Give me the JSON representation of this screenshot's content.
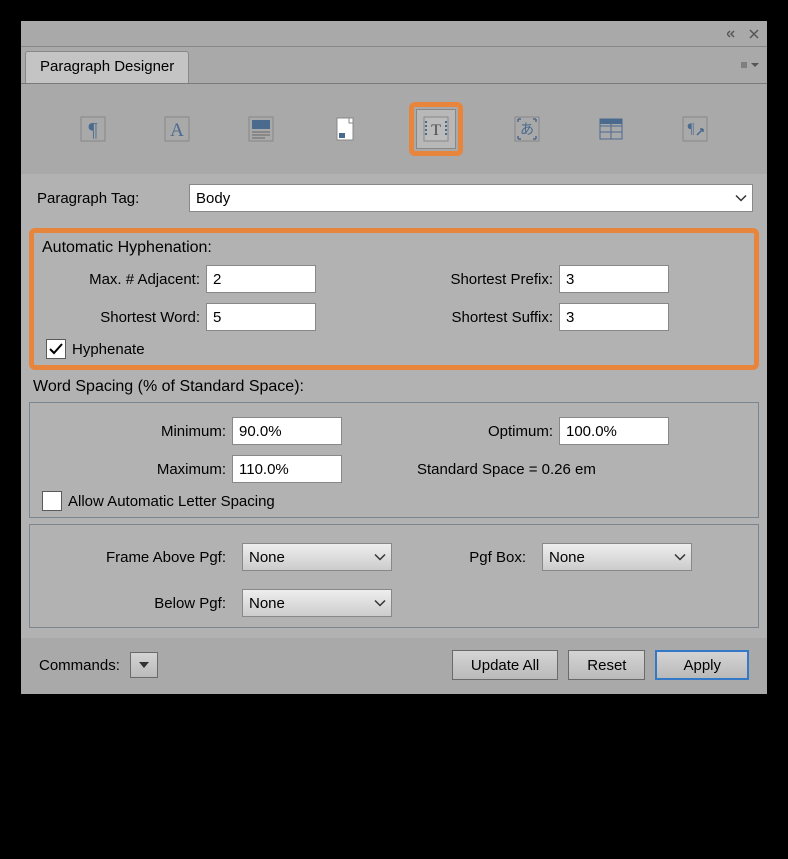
{
  "window": {
    "title": "Paragraph Designer"
  },
  "paragraphTag": {
    "label": "Paragraph Tag:",
    "value": "Body"
  },
  "hyphenation": {
    "title": "Automatic Hyphenation:",
    "maxAdjacent": {
      "label": "Max. # Adjacent:",
      "value": "2"
    },
    "shortestWord": {
      "label": "Shortest Word:",
      "value": "5"
    },
    "shortestPrefix": {
      "label": "Shortest Prefix:",
      "value": "3"
    },
    "shortestSuffix": {
      "label": "Shortest Suffix:",
      "value": "3"
    },
    "hyphenate": {
      "label": "Hyphenate",
      "checked": true
    }
  },
  "wordSpacing": {
    "title": "Word Spacing (% of Standard Space):",
    "minimum": {
      "label": "Minimum:",
      "value": "90.0%"
    },
    "maximum": {
      "label": "Maximum:",
      "value": "110.0%"
    },
    "optimum": {
      "label": "Optimum:",
      "value": "100.0%"
    },
    "standardSpace": "Standard Space = 0.26 em",
    "allowLetterSpacing": {
      "label": "Allow Automatic Letter Spacing",
      "checked": false
    }
  },
  "frames": {
    "frameAbove": {
      "label": "Frame Above Pgf:",
      "value": "None"
    },
    "belowPgf": {
      "label": "Below Pgf:",
      "value": "None"
    },
    "pgfBox": {
      "label": "Pgf Box:",
      "value": "None"
    }
  },
  "buttons": {
    "commands": "Commands:",
    "updateAll": "Update All",
    "reset": "Reset",
    "apply": "Apply"
  },
  "toolbarIcons": [
    "pilcrow",
    "font",
    "shading",
    "page",
    "pagination",
    "asian",
    "tablecell",
    "direction"
  ]
}
